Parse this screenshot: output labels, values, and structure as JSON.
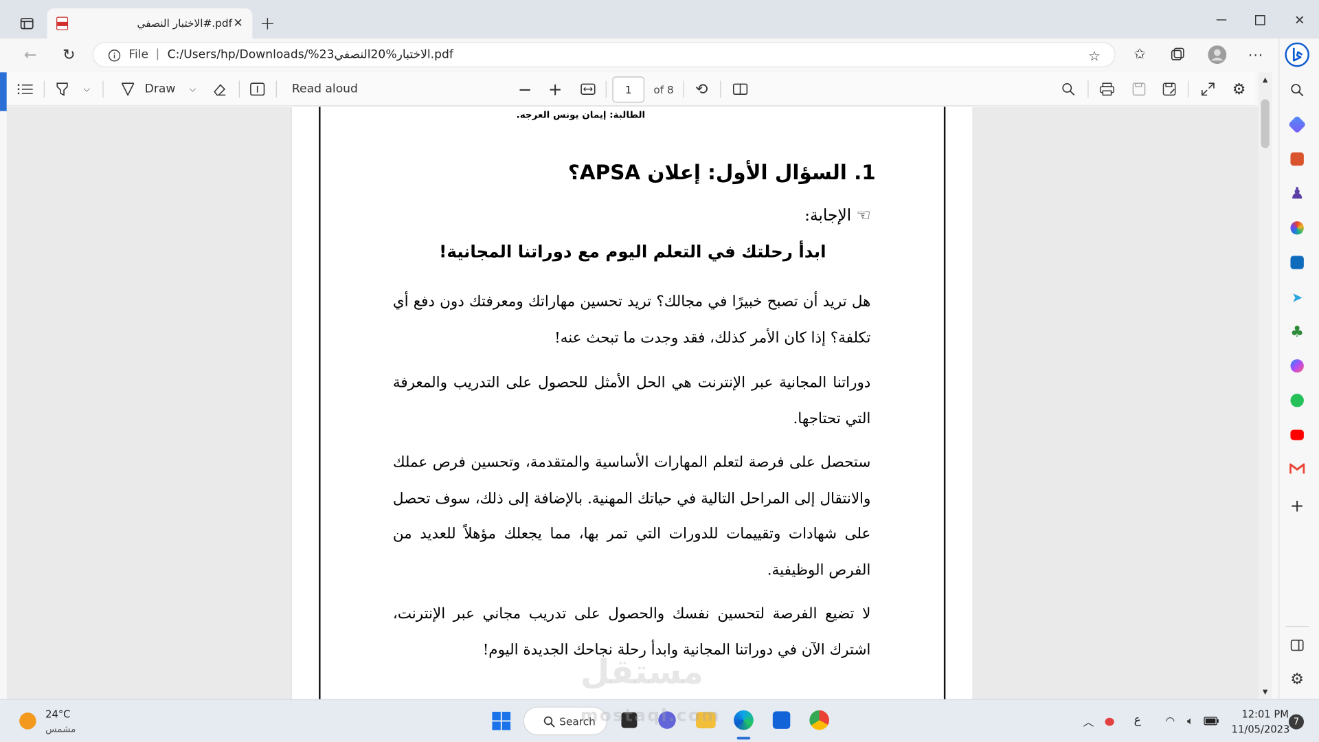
{
  "browser": {
    "tab_title": "الاختبار النصفي#.pdf",
    "address_scheme": "File",
    "address_url": "C:/Users/hp/Downloads/%23الاختبار%20النصفي.pdf"
  },
  "pdf_toolbar": {
    "draw_label": "Draw",
    "read_aloud_label": "Read aloud",
    "page_number": "1",
    "page_count": "of 8"
  },
  "document": {
    "student_line": "الطالبة: إيمان يونس العرجه.",
    "question_title": "1.  السؤال الأول: إعلان APSA؟",
    "answer_label": "☜ الإجابة:",
    "headline": "ابدأ رحلتك في التعلم اليوم مع دوراتنا المجانية!",
    "paragraphs": [
      "هل تريد أن تصبح خبيرًا في مجالك؟ تريد تحسين مهاراتك ومعرفتك دون دفع أي تكلفة؟ إذا كان الأمر كذلك، فقد وجدت ما تبحث عنه!",
      "دوراتنا المجانية عبر الإنترنت هي الحل الأمثل للحصول على التدريب والمعرفة التي تحتاجها.",
      "ستحصل على فرصة لتعلم المهارات الأساسية والمتقدمة، وتحسين فرص عملك والانتقال إلى المراحل التالية في حياتك المهنية. بالإضافة إلى ذلك، سوف تحصل على شهادات وتقييمات للدورات التي تمر بها، مما يجعلك مؤهلاً للعديد من الفرص الوظيفية.",
      "لا تضيع الفرصة لتحسين نفسك والحصول على تدريب مجاني عبر الإنترنت، اشترك الآن في دوراتنا المجانية وابدأ رحلة نجاحك الجديدة اليوم!"
    ]
  },
  "watermark": {
    "arabic": "مستقل",
    "latin": "mostaql.com"
  },
  "taskbar": {
    "weather_temp": "24°C",
    "weather_desc": "مشمس",
    "search_label": "Search",
    "lang_indicator": "ع",
    "time": "12:01 PM",
    "date": "11/05/2023",
    "notification_count": "7"
  },
  "colors": {
    "accent": "#2a6fd6",
    "edge_blue": "#0c59cf",
    "weather_sun": "#f39a1e"
  }
}
